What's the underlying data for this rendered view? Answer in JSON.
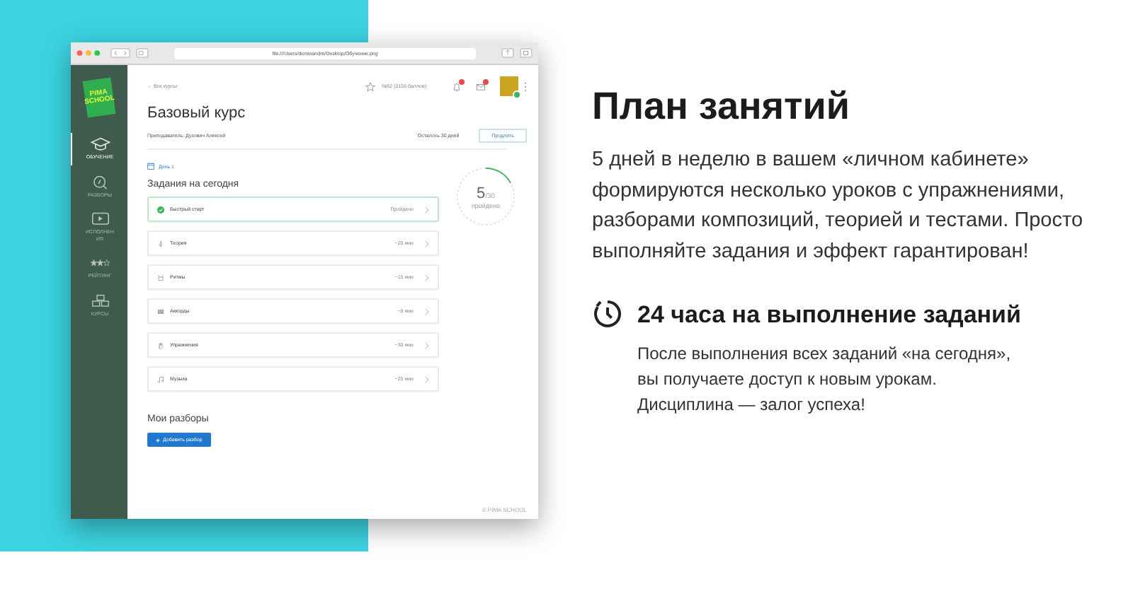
{
  "browser": {
    "url": "file:///Users/deminandre/Desktop/Обучение.png"
  },
  "sidebar": {
    "logo": [
      "PIMA",
      "SCHOOL"
    ],
    "items": [
      {
        "label": "ОБУЧЕНИЕ",
        "kind": "cap",
        "selected": true
      },
      {
        "label": "РАЗБОРЫ",
        "kind": "search",
        "selected": false
      },
      {
        "label": "ИСПОЛНЕНИЯ",
        "kind": "video",
        "selected": false
      },
      {
        "label": "РЕЙТИНГ",
        "kind": "stars",
        "selected": false
      },
      {
        "label": "КУРСЫ",
        "kind": "blocks",
        "selected": false
      }
    ]
  },
  "header": {
    "back_link": "← Все курсы",
    "rating": "№52 (2156 баллов)"
  },
  "course": {
    "title": "Базовый курс",
    "teacher": "Преподаватель: Духович Алексей",
    "remaining": "Осталось 30 дней",
    "extend_button": "Продлить"
  },
  "day": "День 1",
  "tasks_title": "Задания на сегодня",
  "tasks": [
    {
      "name": "Быстрый старт",
      "status": "Пройдено",
      "done": true
    },
    {
      "name": "Теория",
      "status": "~20 мин",
      "kind": "theory",
      "done": false
    },
    {
      "name": "Ритмы",
      "status": "~15 мин",
      "kind": "rhythm",
      "done": false
    },
    {
      "name": "Аккорды",
      "status": "~8 мин",
      "kind": "chords",
      "done": false
    },
    {
      "name": "Упражнения",
      "status": "~30 мин",
      "kind": "exercise",
      "done": false
    },
    {
      "name": "Музыка",
      "status": "~25 мин",
      "kind": "music",
      "done": false
    }
  ],
  "progress": {
    "count": "5",
    "total": "/30",
    "caption": "пройдено",
    "level": 0.17
  },
  "reviews": {
    "title": "Мои разборы",
    "add_button": "Добавить разбор"
  },
  "footer": "© PIMA SCHOOL",
  "promo": {
    "title": "План занятий",
    "lines": [
      "5 дней в неделю в вашем «личном кабинете»",
      "формируются несколько уроков с упражнениями,",
      "разборами композиций, теорией и тестами. Просто",
      "выполняйте задания и эффект гарантирован!"
    ],
    "feature": {
      "title": "24 часа на выполнение заданий",
      "lines": [
        "После выполнения всех заданий «на сегодня»,",
        "вы получаете доступ к новым урокам.",
        "Дисциплина — залог успеха!"
      ]
    }
  }
}
